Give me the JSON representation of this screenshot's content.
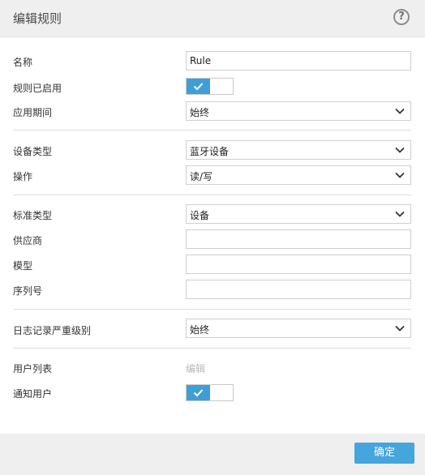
{
  "dialog": {
    "title": "编辑规则"
  },
  "fields": {
    "name": {
      "label": "名称",
      "value": "Rule"
    },
    "rule_enabled": {
      "label": "规则已启用",
      "on": true
    },
    "apply_period": {
      "label": "应用期间",
      "value": "始终"
    },
    "device_type": {
      "label": "设备类型",
      "value": "蓝牙设备"
    },
    "action": {
      "label": "操作",
      "value": "读/写"
    },
    "criteria_type": {
      "label": "标准类型",
      "value": "设备"
    },
    "vendor": {
      "label": "供应商",
      "value": ""
    },
    "model": {
      "label": "模型",
      "value": ""
    },
    "serial": {
      "label": "序列号",
      "value": ""
    },
    "log_severity": {
      "label": "日志记录严重级别",
      "value": "始终"
    },
    "user_list": {
      "label": "用户列表",
      "edit_link": "编辑"
    },
    "notify_user": {
      "label": "通知用户",
      "on": true
    }
  },
  "footer": {
    "ok_label": "确定"
  },
  "colors": {
    "accent": "#45a5dc",
    "toggle_on": "#3e9fd6",
    "header_bg": "#efefef"
  }
}
